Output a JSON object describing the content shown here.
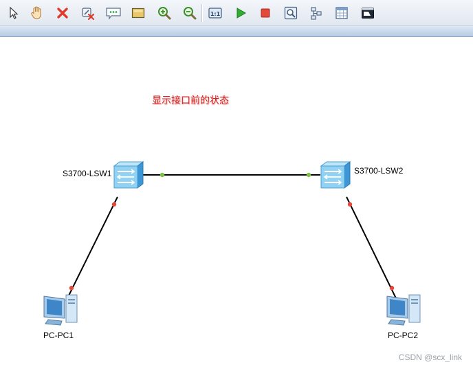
{
  "toolbar": {
    "buttons": [
      {
        "name": "select-icon"
      },
      {
        "name": "pan-hand-icon"
      },
      {
        "name": "delete-icon"
      },
      {
        "name": "delete-link-icon"
      },
      {
        "name": "text-note-icon"
      },
      {
        "name": "rectangle-icon"
      },
      {
        "name": "zoom-in-icon"
      },
      {
        "name": "zoom-out-icon"
      },
      {
        "name": "fit-view-icon"
      },
      {
        "name": "start-device-icon"
      },
      {
        "name": "stop-device-icon"
      },
      {
        "name": "capture-icon"
      },
      {
        "name": "topology-icon"
      },
      {
        "name": "grid-table-icon"
      },
      {
        "name": "terminal-icon"
      }
    ],
    "colors": {
      "start": "#2fae2f",
      "stop": "#e24b3b",
      "delete": "#e03a2a"
    }
  },
  "canvas": {
    "annotation": "显示接口前的状态",
    "devices": {
      "lsw1": {
        "label": "S3700-LSW1",
        "type": "switch-icon"
      },
      "lsw2": {
        "label": "S3700-LSW2",
        "type": "switch-icon"
      },
      "pc1": {
        "label": "PC-PC1",
        "type": "pc-icon"
      },
      "pc2": {
        "label": "PC-PC2",
        "type": "pc-icon"
      }
    },
    "links": [
      {
        "from": "S3700-LSW1",
        "to": "S3700-LSW2",
        "status": "up",
        "port_color": "#7dc243"
      },
      {
        "from": "S3700-LSW1",
        "to": "PC-PC1",
        "status": "down",
        "port_color": "#e8463a"
      },
      {
        "from": "S3700-LSW2",
        "to": "PC-PC2",
        "status": "down",
        "port_color": "#e8463a"
      }
    ]
  },
  "watermark": "CSDN @scx_link"
}
